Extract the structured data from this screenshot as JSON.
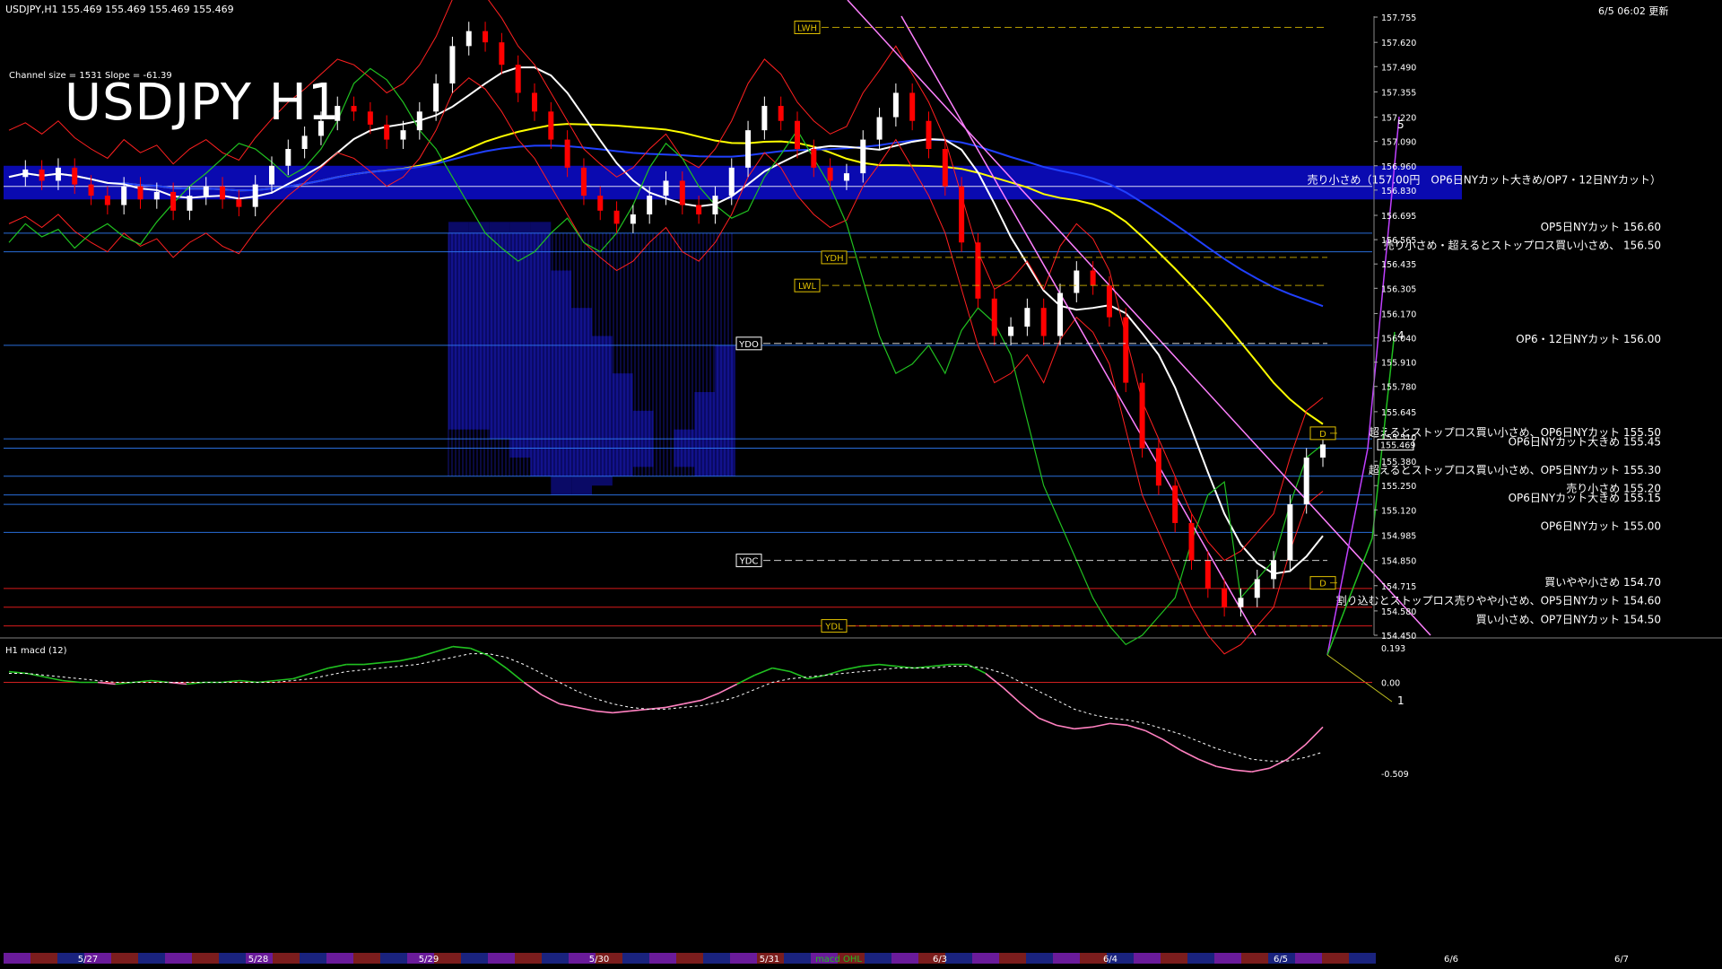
{
  "header": {
    "symbol_info": "USDJPY,H1  155.469 155.469 155.469 155.469",
    "datetime": "6/5 06:02 更新",
    "channel_info": "Channel size = 1531 Slope = -61.39",
    "title": "USDJPY H1"
  },
  "colors": {
    "background": "#000000",
    "bull_candle": "#ffffff",
    "bear_candle": "#ff0000",
    "kumo": "#1010a0",
    "sma_white": "#ffffff",
    "sma_yellow": "#ffff00",
    "sma_blue": "#2040ff",
    "chikou_green": "#20c020",
    "ichimoku_line": "#e0e040",
    "resistance_line": "#ff2020",
    "support_line": "#3080ff",
    "channel_pink": "#ff80ff",
    "macd_main": "#20c020",
    "macd_main_neg": "#ff80c0",
    "macd_signal": "#ffffff"
  },
  "chart_data": [
    {
      "type": "line",
      "panel": "main",
      "title": "USDJPY H1",
      "ylim": [
        154.45,
        157.76
      ],
      "y_ticks": [
        "157.755",
        "157.620",
        "157.490",
        "157.355",
        "157.220",
        "157.090",
        "156.960",
        "156.830",
        "156.695",
        "156.565",
        "156.435",
        "156.305",
        "156.170",
        "156.040",
        "155.910",
        "155.780",
        "155.645",
        "155.510",
        "155.380",
        "155.250",
        "155.120",
        "154.985",
        "154.850",
        "154.715",
        "154.580",
        "154.450"
      ],
      "current_price": "155.469",
      "x_ticks": [
        "5/27",
        "5/28",
        "5/29",
        "5/30",
        "5/31",
        "6/3",
        "6/4",
        "6/5",
        "6/6",
        "6/7"
      ],
      "price_levels": [
        {
          "label": "売り小さめ（157.00円　OP6日NYカット大きめ/OP7・12日NYカット）",
          "value": 156.85,
          "color": "#ffffff"
        },
        {
          "label": "OP5日NYカット 156.60",
          "value": 156.6,
          "color": "#3080ff"
        },
        {
          "label": "売り小さめ・超えるとストップロス買い小さめ、 156.50",
          "value": 156.5,
          "color": "#3080ff"
        },
        {
          "label": "OP6・12日NYカット 156.00",
          "value": 156.0,
          "color": "#3080ff"
        },
        {
          "label": "超えるとストップロス買い小さめ、OP6日NYカット 155.50",
          "value": 155.5,
          "color": "#3080ff"
        },
        {
          "label": "OP6日NYカット大きめ 155.45",
          "value": 155.45,
          "color": "#3080ff"
        },
        {
          "label": "超えるとストップロス買い小さめ、OP5日NYカット 155.30",
          "value": 155.3,
          "color": "#3080ff"
        },
        {
          "label": "売り小さめ 155.20",
          "value": 155.2,
          "color": "#3080ff"
        },
        {
          "label": "OP6日NYカット大きめ 155.15",
          "value": 155.15,
          "color": "#3080ff"
        },
        {
          "label": "OP6日NYカット 155.00",
          "value": 155.0,
          "color": "#3080ff"
        },
        {
          "label": "買いやや小さめ 154.70",
          "value": 154.7,
          "color": "#ff2020"
        },
        {
          "label": "割り込むとストップロス売りやや小さめ、OP5日NYカット 154.60",
          "value": 154.6,
          "color": "#ff2020"
        },
        {
          "label": "買い小さめ、OP7日NYカット 154.50",
          "value": 154.5,
          "color": "#ff2020"
        }
      ],
      "markers": [
        {
          "label": "LWH",
          "value": 157.7
        },
        {
          "label": "YDH",
          "value": 156.47
        },
        {
          "label": "LWL",
          "value": 156.32
        },
        {
          "label": "YDO",
          "value": 156.01
        },
        {
          "label": "YDC",
          "value": 154.85
        },
        {
          "label": "YDL",
          "value": 154.5
        },
        {
          "label": "D",
          "value": 155.53
        },
        {
          "label": "D",
          "value": 154.73
        }
      ],
      "wave_labels": [
        "5",
        "4",
        "1"
      ],
      "series": [
        {
          "values": [
            156.9,
            156.94,
            156.88,
            156.95,
            156.86,
            156.8,
            156.75,
            156.85,
            156.78,
            156.82,
            156.72,
            156.8,
            156.85,
            156.78,
            156.74,
            156.86,
            156.96,
            157.05,
            157.12,
            157.2,
            157.28,
            157.25,
            157.18,
            157.1,
            157.15,
            157.25,
            157.4,
            157.6,
            157.68,
            157.62,
            157.5,
            157.35,
            157.25,
            157.1,
            156.95,
            156.8,
            156.72,
            156.65,
            156.7,
            156.8,
            156.88,
            156.75,
            156.7,
            156.8,
            156.95,
            157.15,
            157.28,
            157.2,
            157.05,
            156.95,
            156.88,
            156.92,
            157.1,
            157.22,
            157.35,
            157.2,
            157.05,
            156.85,
            156.55,
            156.25,
            156.05,
            156.1,
            156.2,
            156.05,
            156.28,
            156.4,
            156.32,
            156.15,
            155.8,
            155.45,
            155.25,
            155.05,
            154.85,
            154.7,
            154.6,
            154.65,
            154.75,
            154.85,
            155.15,
            155.4,
            155.47
          ]
        }
      ]
    },
    {
      "type": "line",
      "panel": "macd",
      "title": "H1 macd (12)",
      "ylim": [
        -0.509,
        0.193
      ],
      "y_ticks": [
        "0.193",
        "0.00",
        "-0.509"
      ],
      "series": [
        {
          "values": [
            0.06,
            0.05,
            0.03,
            0.01,
            0.0,
            0.0,
            -0.01,
            0.0,
            0.01,
            0.0,
            -0.01,
            0.0,
            0.0,
            0.01,
            0.0,
            0.01,
            0.02,
            0.05,
            0.08,
            0.1,
            0.1,
            0.11,
            0.12,
            0.14,
            0.17,
            0.2,
            0.19,
            0.15,
            0.08,
            0.0,
            -0.07,
            -0.12,
            -0.14,
            -0.16,
            -0.17,
            -0.16,
            -0.15,
            -0.14,
            -0.12,
            -0.1,
            -0.06,
            -0.01,
            0.04,
            0.08,
            0.06,
            0.02,
            0.04,
            0.07,
            0.09,
            0.1,
            0.09,
            0.08,
            0.09,
            0.1,
            0.1,
            0.05,
            -0.03,
            -0.12,
            -0.2,
            -0.24,
            -0.26,
            -0.25,
            -0.23,
            -0.24,
            -0.27,
            -0.32,
            -0.38,
            -0.43,
            -0.47,
            -0.49,
            -0.5,
            -0.48,
            -0.43,
            -0.35,
            -0.25
          ]
        },
        {
          "values": [
            0.05,
            0.05,
            0.04,
            0.03,
            0.02,
            0.01,
            0.0,
            0.0,
            0.0,
            0.0,
            0.0,
            0.0,
            0.0,
            0.0,
            0.0,
            0.0,
            0.01,
            0.02,
            0.04,
            0.06,
            0.07,
            0.08,
            0.09,
            0.1,
            0.12,
            0.14,
            0.16,
            0.16,
            0.14,
            0.1,
            0.05,
            0.0,
            -0.05,
            -0.09,
            -0.12,
            -0.14,
            -0.15,
            -0.15,
            -0.14,
            -0.13,
            -0.11,
            -0.08,
            -0.04,
            0.0,
            0.02,
            0.03,
            0.04,
            0.05,
            0.06,
            0.07,
            0.08,
            0.08,
            0.08,
            0.09,
            0.09,
            0.08,
            0.05,
            0.0,
            -0.05,
            -0.1,
            -0.15,
            -0.18,
            -0.2,
            -0.21,
            -0.23,
            -0.26,
            -0.29,
            -0.33,
            -0.37,
            -0.4,
            -0.43,
            -0.44,
            -0.44,
            -0.42,
            -0.39
          ]
        }
      ]
    }
  ],
  "macd_button": "macd OHL"
}
